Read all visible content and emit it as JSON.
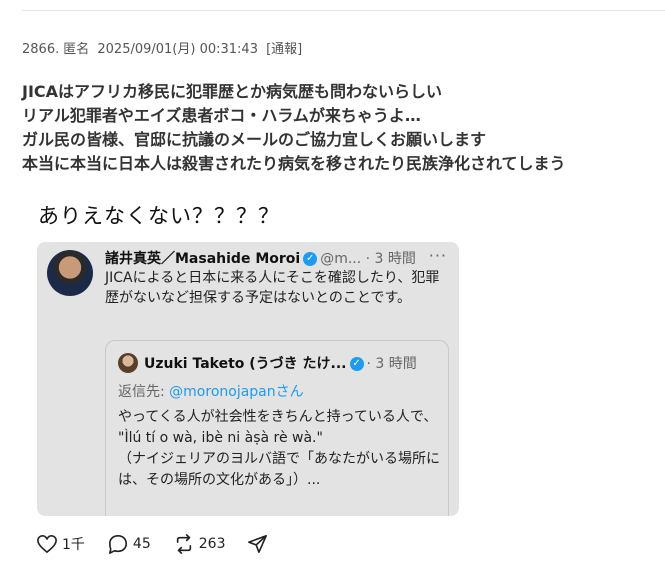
{
  "post": {
    "number": "2866.",
    "author": "匿名",
    "timestamp": "2025/09/01(月) 00:31:43",
    "report_label": "[通報]",
    "lines": [
      "JICAはアフリカ移民に犯罪歴とか病気歴も問わないらしい",
      "リアル犯罪者やエイズ患者ボコ・ハラムが来ちゃうよ…",
      "ガル民の皆様、官邸に抗議のメールのご協力宜しくお願いします",
      "本当に本当に日本人は殺害されたり病気を移されたり民族浄化されてしまう"
    ]
  },
  "embed": {
    "caption": "ありえなくない？？？？",
    "tweet": {
      "name": "諸井真英／Masahide Moroi",
      "handle_time": "@m... · 3 時間",
      "more": "···",
      "text": "JICAによると日本に来る人にそこを確認したり、犯罪歴がないなど担保する予定はないとのことです。",
      "quote": {
        "name": "Uzuki Taketo (うづき たけ...",
        "time": "· 3 時間",
        "reply_prefix": "返信先: ",
        "reply_mention": "@moronojapan",
        "reply_suffix": "さん",
        "lines": [
          "やってくる人が社会性をきちんと持っている人で、",
          "\"Ìlú tí o wà, ibè ni àṣà rè wà.\"",
          "（ナイジェリアのヨルバ語で「あなたがいる場所には、その場所の文化がある」）..."
        ]
      }
    }
  },
  "actions": {
    "likes": "1千",
    "replies": "45",
    "reposts": "263"
  },
  "colors": {
    "verified": "#1d9bf0",
    "card_bg": "#e3e3e3",
    "mention": "#1d9bf0"
  }
}
